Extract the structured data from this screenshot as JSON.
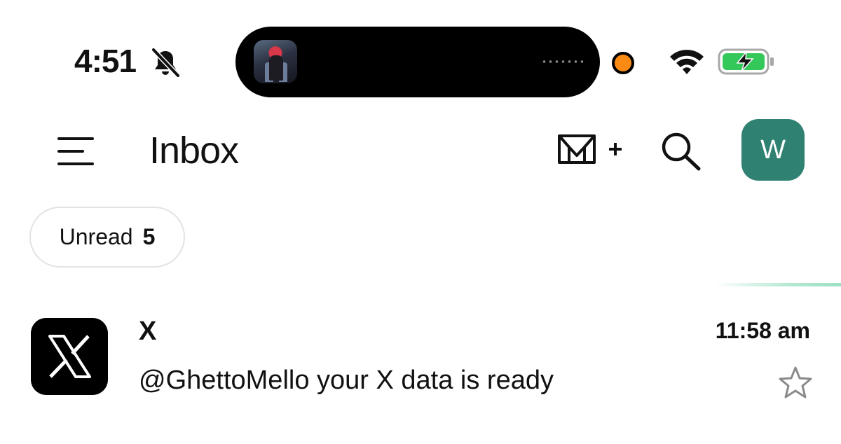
{
  "status_bar": {
    "time": "4:51",
    "icons": [
      "bell-muted-icon",
      "dynamic-island-media",
      "recording-dot",
      "wifi-icon",
      "battery-charging-icon"
    ],
    "colors": {
      "recording_dot": "#fa8a14",
      "battery_fill": "#34c759"
    }
  },
  "header": {
    "title": "Inbox",
    "icons": [
      "menu-icon",
      "compose-icon",
      "search-icon"
    ],
    "avatar_initial": "W",
    "avatar_color": "#2f8172"
  },
  "filters": {
    "chip_label": "Unread",
    "chip_count": "5"
  },
  "messages": [
    {
      "sender": "X",
      "subject": "@GhettoMello your X data is ready",
      "time": "11:58 am",
      "logo": "x-logo-icon",
      "starred": false
    }
  ]
}
